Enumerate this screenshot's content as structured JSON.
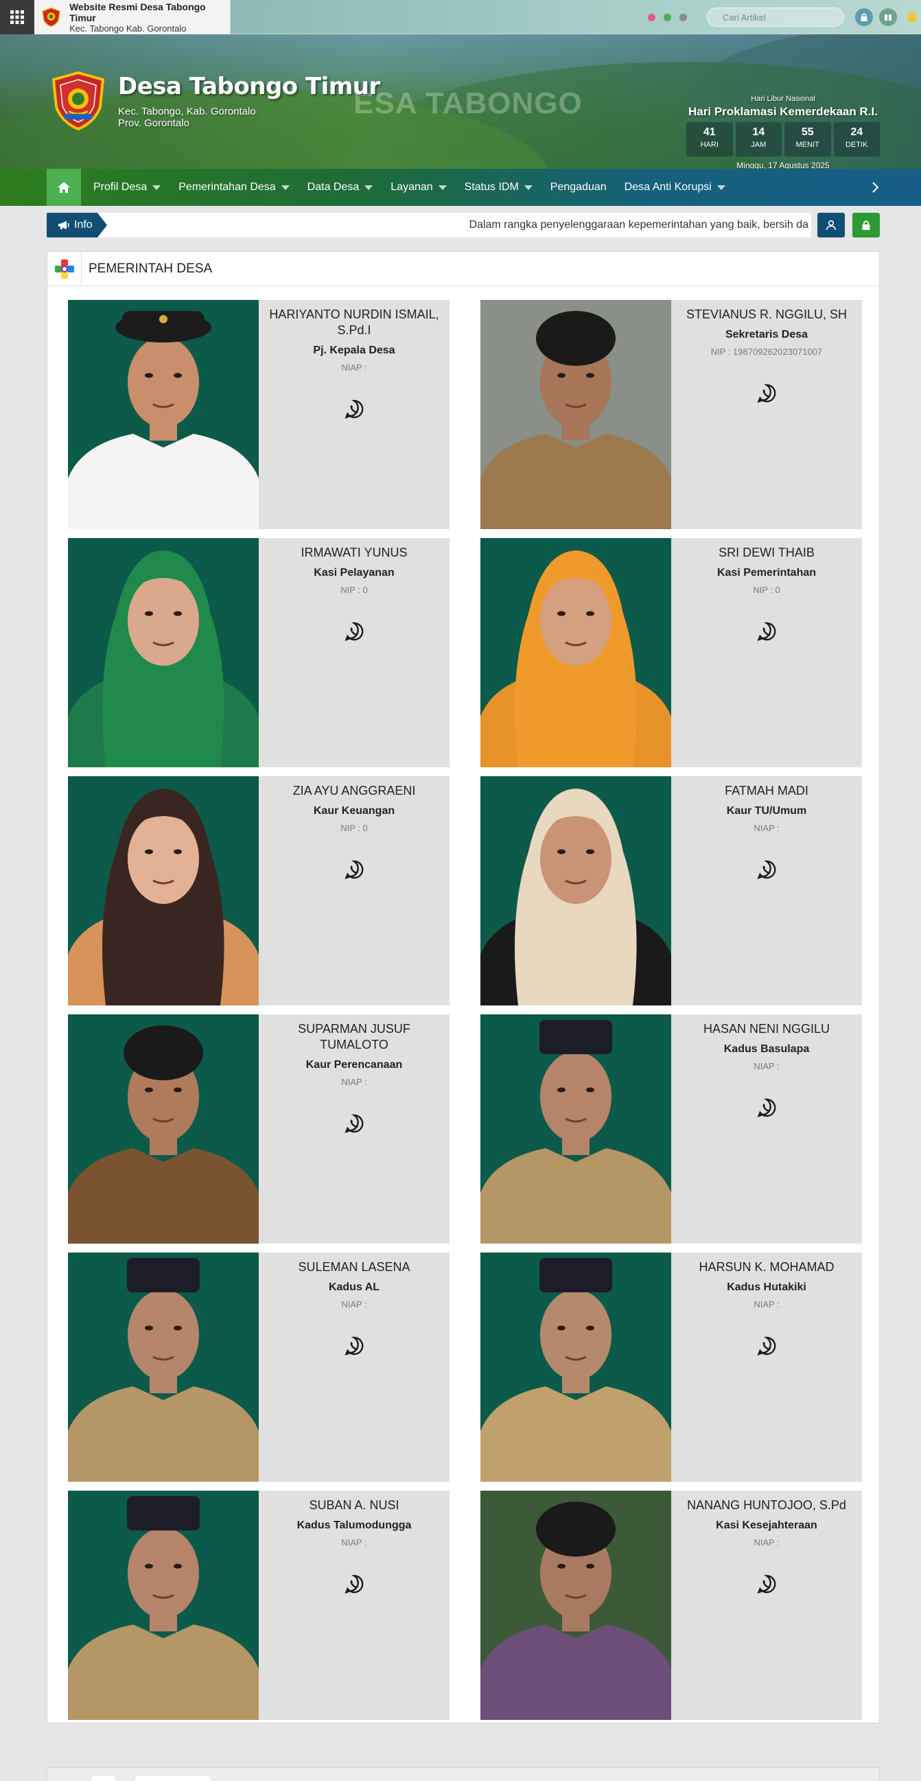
{
  "topbar": {
    "site_name": "Website Resmi Desa Tabongo Timur",
    "site_location": "Kec. Tabongo Kab. Gorontalo",
    "search_placeholder": "Cari Artikel",
    "dot_colors": [
      "#e05a8a",
      "#4caf50",
      "#8a8a8a"
    ]
  },
  "header": {
    "title": "Desa Tabongo Timur",
    "subtitle_line1": "Kec. Tabongo, Kab. Gorontalo",
    "subtitle_line2": "Prov. Gorontalo",
    "background_text": "ESA TABONGO",
    "countdown": {
      "small_label": "Hari Libur Nasional",
      "event": "Hari Proklamasi Kemerdekaan R.I.",
      "units": [
        {
          "value": "41",
          "label": "HARI"
        },
        {
          "value": "14",
          "label": "JAM"
        },
        {
          "value": "55",
          "label": "MENIT"
        },
        {
          "value": "24",
          "label": "DETIK"
        }
      ],
      "date": "Minggu, 17 Agustus 2025"
    }
  },
  "nav": {
    "items": [
      {
        "label": "Profil Desa",
        "dropdown": true
      },
      {
        "label": "Pemerintahan Desa",
        "dropdown": true
      },
      {
        "label": "Data Desa",
        "dropdown": true
      },
      {
        "label": "Layanan",
        "dropdown": true
      },
      {
        "label": "Status IDM",
        "dropdown": true
      },
      {
        "label": "Pengaduan",
        "dropdown": false
      },
      {
        "label": "Desa Anti Korupsi",
        "dropdown": true
      }
    ]
  },
  "info": {
    "label": "Info",
    "text": "Dalam rangka penyelenggaraan kepemerintahan yang baik, bersih da"
  },
  "section": {
    "title": "PEMERINTAH DESA"
  },
  "people": [
    {
      "name": "HARIYANTO NURDIN ISMAIL, S.Pd.I",
      "role": "Pj. Kepala Desa",
      "nip": "NIAP :",
      "photo": {
        "bg": "#0c5a4a",
        "cloth": "#f4f4f4",
        "skin": "#c98e6b",
        "head": "cap"
      }
    },
    {
      "name": "STEVIANUS R. NGGILU, SH",
      "role": "Sekretaris Desa",
      "nip": "NIP : 198709262023071007",
      "photo": {
        "bg": "#8a8f87",
        "cloth": "#9c7a4e",
        "skin": "#a87658",
        "head": "hair"
      }
    },
    {
      "name": "IRMAWATI YUNUS",
      "role": "Kasi Pelayanan",
      "nip": "NIP : 0",
      "photo": {
        "bg": "#0c5a4a",
        "cloth": "#1d7a4a",
        "skin": "#d9a88d",
        "head": "hijab-green"
      }
    },
    {
      "name": "SRI DEWI THAIB",
      "role": "Kasi Pemerintahan",
      "nip": "NIP : 0",
      "photo": {
        "bg": "#0c5a4a",
        "cloth": "#e8932a",
        "skin": "#d4a07f",
        "head": "hijab-orange"
      }
    },
    {
      "name": "ZIA AYU ANGGRAENI",
      "role": "Kaur Keuangan",
      "nip": "NIP : 0",
      "photo": {
        "bg": "#0c5a4a",
        "cloth": "#d8935b",
        "skin": "#e3b196",
        "head": "hijab-brown"
      }
    },
    {
      "name": "FATMAH MADI",
      "role": "Kaur TU/Umum",
      "nip": "NIAP :",
      "photo": {
        "bg": "#0c5a4a",
        "cloth": "#1a1a1a",
        "skin": "#c99377",
        "head": "hijab-floral"
      }
    },
    {
      "name": "SUPARMAN JUSUF TUMALOTO",
      "role": "Kaur Perencanaan",
      "nip": "NIAP :",
      "photo": {
        "bg": "#0c5a4a",
        "cloth": "#7a5430",
        "skin": "#b07a5c",
        "head": "hair"
      }
    },
    {
      "name": "HASAN NENI NGGILU",
      "role": "Kadus Basulapa",
      "nip": "NIAP :",
      "photo": {
        "bg": "#0c5a4a",
        "cloth": "#b59666",
        "skin": "#b5846a",
        "head": "peci"
      }
    },
    {
      "name": "SULEMAN LASENA",
      "role": "Kadus AL",
      "nip": "NIAP :",
      "photo": {
        "bg": "#0c5a4a",
        "cloth": "#b59666",
        "skin": "#b5866c",
        "head": "peci"
      }
    },
    {
      "name": "HARSUN K. MOHAMAD",
      "role": "Kadus Hutakiki",
      "nip": "NIAP :",
      "photo": {
        "bg": "#0c5a4a",
        "cloth": "#c0a06c",
        "skin": "#b58a6c",
        "head": "peci"
      }
    },
    {
      "name": "SUBAN A. NUSI",
      "role": "Kadus Talumodungga",
      "nip": "NIAP :",
      "photo": {
        "bg": "#0c5a4a",
        "cloth": "#b59666",
        "skin": "#b5846a",
        "head": "peci"
      }
    },
    {
      "name": "NANANG HUNTOJOO, S.Pd",
      "role": "Kasi Kesejahteraan",
      "nip": "NIAP :",
      "photo": {
        "bg": "#3c5a38",
        "cloth": "#6b4f78",
        "skin": "#a87a62",
        "head": "hair"
      }
    }
  ]
}
